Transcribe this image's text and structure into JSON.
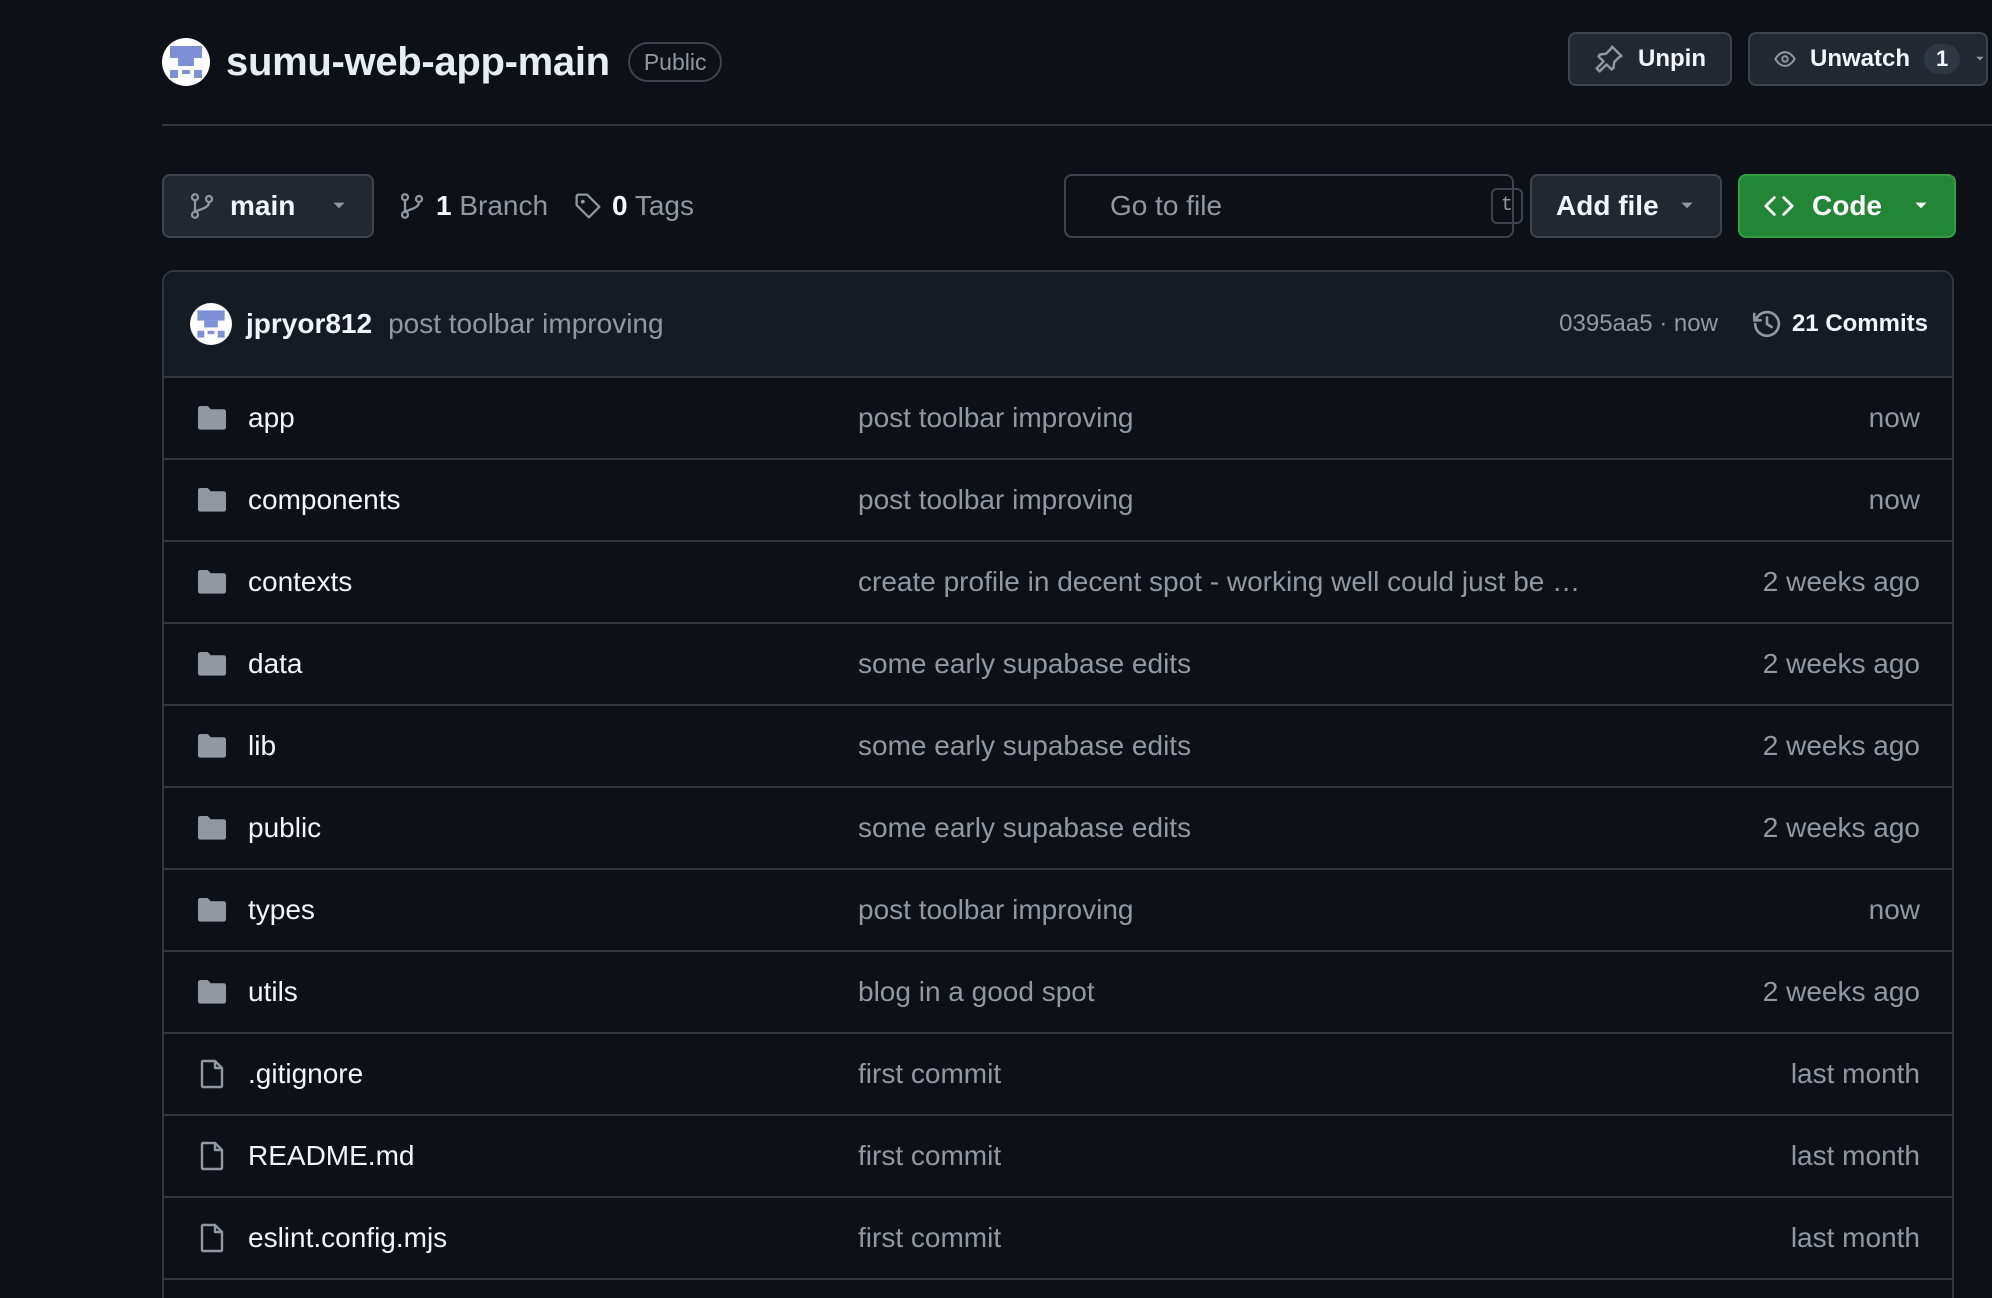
{
  "repo": {
    "name": "sumu-web-app-main",
    "visibility": "Public"
  },
  "header_actions": {
    "unpin_label": "Unpin",
    "unwatch_label": "Unwatch",
    "watch_count": "1"
  },
  "toolbar": {
    "branch": "main",
    "branch_count": "1",
    "branch_label": "Branch",
    "tag_count": "0",
    "tag_label": "Tags",
    "search_placeholder": "Go to file",
    "search_shortcut": "t",
    "add_file_label": "Add file",
    "code_label": "Code"
  },
  "latest_commit": {
    "author": "jpryor812",
    "message": "post toolbar improving",
    "hash_time": "0395aa5 · now",
    "commits_label": "21 Commits"
  },
  "files": [
    {
      "type": "folder",
      "icon": "folder-icon",
      "name": "app",
      "commit": "post toolbar improving",
      "age": "now"
    },
    {
      "type": "folder",
      "icon": "folder-icon",
      "name": "components",
      "commit": "post toolbar improving",
      "age": "now"
    },
    {
      "type": "folder",
      "icon": "folder-icon",
      "name": "contexts",
      "commit": "create profile in decent spot - working well could just be …",
      "age": "2 weeks ago"
    },
    {
      "type": "folder",
      "icon": "folder-icon",
      "name": "data",
      "commit": "some early supabase edits",
      "age": "2 weeks ago"
    },
    {
      "type": "folder",
      "icon": "folder-icon",
      "name": "lib",
      "commit": "some early supabase edits",
      "age": "2 weeks ago"
    },
    {
      "type": "folder",
      "icon": "folder-icon",
      "name": "public",
      "commit": "some early supabase edits",
      "age": "2 weeks ago"
    },
    {
      "type": "folder",
      "icon": "folder-icon",
      "name": "types",
      "commit": "post toolbar improving",
      "age": "now"
    },
    {
      "type": "folder",
      "icon": "folder-icon",
      "name": "utils",
      "commit": "blog in a good spot",
      "age": "2 weeks ago"
    },
    {
      "type": "file",
      "icon": "file-icon",
      "name": ".gitignore",
      "commit": "first commit",
      "age": "last month"
    },
    {
      "type": "file",
      "icon": "file-icon",
      "name": "README.md",
      "commit": "first commit",
      "age": "last month"
    },
    {
      "type": "file",
      "icon": "file-icon",
      "name": "eslint.config.mjs",
      "commit": "first commit",
      "age": "last month"
    }
  ],
  "colors": {
    "background": "#0d1117",
    "code_button": "#238636",
    "folder_icon": "#9198a1"
  }
}
